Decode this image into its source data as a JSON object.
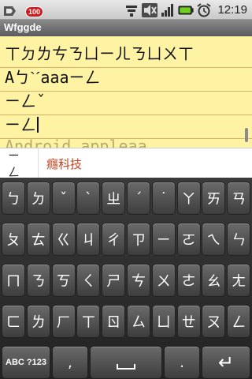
{
  "status_bar": {
    "notification_count": "100",
    "time": "12:19",
    "icons": [
      "usb-debug-icon",
      "notification-badge-icon",
      "wifi-icon",
      "mute-icon",
      "signal-icon",
      "battery-icon",
      "alarm-icon"
    ]
  },
  "app": {
    "title": "Wfggde"
  },
  "note": {
    "lines": [
      "ㄒㄉㄌㄘㄋㄩㄧㄦㄋㄩㄨㄒ",
      "Aㄅˋˊaaaㄧㄥ",
      "ㄧㄥˇ",
      "ㄧㄥ",
      "Android appleaa"
    ]
  },
  "candidates": [
    "ㄧㄥ",
    "癮科技"
  ],
  "keyboard": {
    "rows": [
      [
        "ㄅ",
        "ㄉ",
        "ˇ",
        "ˋ",
        "ㄓ",
        "ˊ",
        "˙",
        "ㄚ",
        "ㄞ",
        "ㄢ"
      ],
      [
        "ㄆ",
        "ㄊ",
        "ㄍ",
        "ㄐ",
        "ㄔ",
        "ㄗ",
        "ㄧ",
        "ㄛ",
        "ㄟ",
        "ㄣ"
      ],
      [
        "ㄇ",
        "ㄋ",
        "ㄎ",
        "ㄑ",
        "ㄕ",
        "ㄘ",
        "ㄨ",
        "ㄜ",
        "ㄠ",
        "ㄤ"
      ],
      [
        "ㄈ",
        "ㄌ",
        "ㄏ",
        "ㄒ",
        "ㄖ",
        "ㄙ",
        "ㄩ",
        "ㄝ",
        "ㄡ",
        "ㄥ"
      ]
    ],
    "bottom": {
      "mode": "ABC ?123",
      "comma": ",",
      "space": "",
      "period": ".",
      "enter": "↵"
    }
  }
}
